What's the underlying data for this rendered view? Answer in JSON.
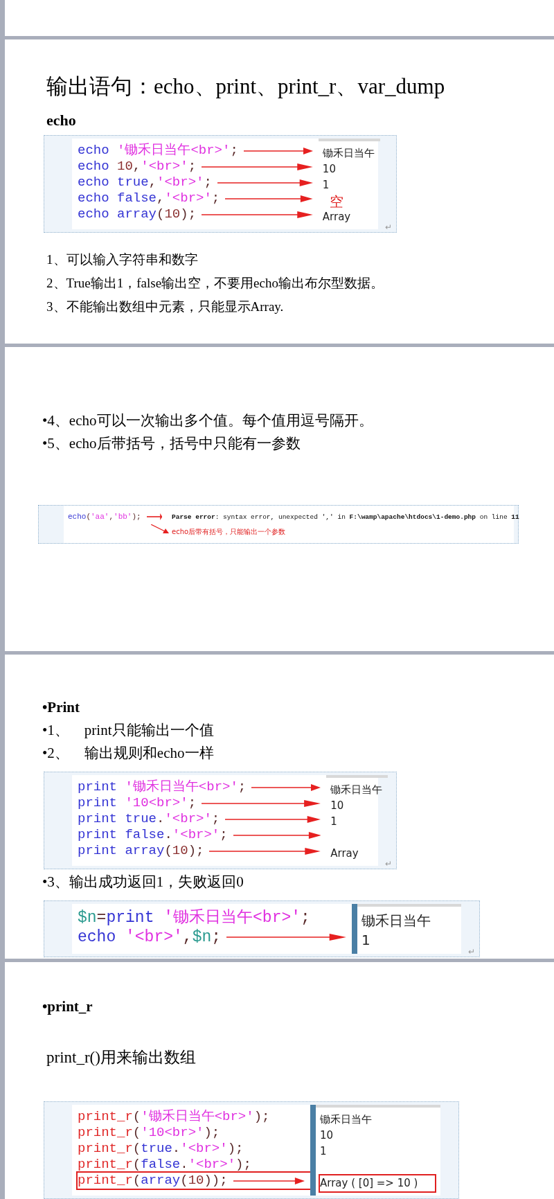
{
  "slides": [
    {
      "blocks": [
        {
          "kind": "title",
          "text": "输出语句：echo、print、print_r、var_dump"
        },
        {
          "kind": "heading",
          "text": "echo"
        },
        {
          "kind": "code",
          "end_mark": "↵",
          "rows": [
            {
              "tokens": [
                {
                  "kind": "kw",
                  "text": "echo "
                },
                {
                  "kind": "str",
                  "text": "'锄禾日当午<br>'"
                },
                {
                  "kind": "punct",
                  "text": ";"
                }
              ],
              "arrow": true,
              "output": {
                "kind": "text",
                "text": "锄禾日当午"
              }
            },
            {
              "tokens": [
                {
                  "kind": "kw",
                  "text": "echo "
                },
                {
                  "kind": "num",
                  "text": "10"
                },
                {
                  "kind": "punct",
                  "text": ","
                },
                {
                  "kind": "str",
                  "text": "'<br>'"
                },
                {
                  "kind": "punct",
                  "text": ";"
                }
              ],
              "arrow": true,
              "output": {
                "kind": "text",
                "text": "10"
              }
            },
            {
              "tokens": [
                {
                  "kind": "kw",
                  "text": "echo true"
                },
                {
                  "kind": "punct",
                  "text": ","
                },
                {
                  "kind": "str",
                  "text": "'<br>'"
                },
                {
                  "kind": "punct",
                  "text": ";"
                }
              ],
              "arrow": true,
              "output": {
                "kind": "text",
                "text": "1"
              }
            },
            {
              "tokens": [
                {
                  "kind": "kw",
                  "text": "echo false"
                },
                {
                  "kind": "punct",
                  "text": ","
                },
                {
                  "kind": "str",
                  "text": "'<br>'"
                },
                {
                  "kind": "punct",
                  "text": ";"
                }
              ],
              "arrow": true,
              "output": {
                "kind": "note",
                "text": "空"
              }
            },
            {
              "tokens": [
                {
                  "kind": "kw",
                  "text": "echo array"
                },
                {
                  "kind": "punct",
                  "text": "("
                },
                {
                  "kind": "num",
                  "text": "10"
                },
                {
                  "kind": "punct",
                  "text": ");"
                }
              ],
              "arrow": true,
              "output": {
                "kind": "text",
                "text": "Array"
              }
            }
          ]
        },
        {
          "kind": "lines",
          "items": [
            "1、可以输入字符串和数字",
            "2、True输出1，false输出空，不要用echo输出布尔型数据。",
            "3、不能输出数组中元素，只能显示Array."
          ]
        }
      ]
    },
    {
      "blocks": [
        {
          "kind": "bullets",
          "items": [
            {
              "marker": "•",
              "text": "4、echo可以一次输出多个值。每个值用逗号隔开。",
              "bold": false
            },
            {
              "marker": "•",
              "text": "5、echo后带括号，括号中只能有一参数",
              "bold": false
            }
          ]
        },
        {
          "kind": "error",
          "tokens": [
            {
              "kind": "kw",
              "text": "echo"
            },
            {
              "kind": "punct",
              "text": "("
            },
            {
              "kind": "str",
              "text": "'aa'"
            },
            {
              "kind": "punct",
              "text": ","
            },
            {
              "kind": "str",
              "text": "'bb'"
            },
            {
              "kind": "punct",
              "text": ");"
            }
          ],
          "message": "**Parse error**: syntax error, unexpected ',' in **F:\\wamp\\apache\\htdocs\\1-demo.php** on line **11**",
          "note": "echo后带有括号，只能输出一个参数"
        }
      ]
    },
    {
      "blocks": [
        {
          "kind": "bullets",
          "items": [
            {
              "marker": "•",
              "text": "Print",
              "bold": true
            },
            {
              "marker": "•",
              "number": "1、",
              "text": "print只能输出一个值",
              "bold": false
            },
            {
              "marker": "•",
              "number": "2、",
              "text": "输出规则和echo一样",
              "bold": false
            }
          ]
        },
        {
          "kind": "code",
          "end_mark": "↵",
          "rows": [
            {
              "tokens": [
                {
                  "kind": "kw",
                  "text": "print "
                },
                {
                  "kind": "str",
                  "text": "'锄禾日当午<br>'"
                },
                {
                  "kind": "punct",
                  "text": ";"
                }
              ],
              "arrow": true,
              "output": {
                "kind": "text",
                "text": "锄禾日当午"
              }
            },
            {
              "tokens": [
                {
                  "kind": "kw",
                  "text": "print "
                },
                {
                  "kind": "str",
                  "text": "'10<br>'"
                },
                {
                  "kind": "punct",
                  "text": ";"
                }
              ],
              "arrow": true,
              "output": {
                "kind": "text",
                "text": "10"
              }
            },
            {
              "tokens": [
                {
                  "kind": "kw",
                  "text": "print true"
                },
                {
                  "kind": "punct",
                  "text": "."
                },
                {
                  "kind": "str",
                  "text": "'<br>'"
                },
                {
                  "kind": "punct",
                  "text": ";"
                }
              ],
              "arrow": true,
              "output": {
                "kind": "text",
                "text": "1"
              }
            },
            {
              "tokens": [
                {
                  "kind": "kw",
                  "text": "print false"
                },
                {
                  "kind": "punct",
                  "text": "."
                },
                {
                  "kind": "str",
                  "text": "'<br>'"
                },
                {
                  "kind": "punct",
                  "text": ";"
                }
              ],
              "arrow": true
            },
            {
              "tokens": [
                {
                  "kind": "kw",
                  "text": "print array"
                },
                {
                  "kind": "punct",
                  "text": "("
                },
                {
                  "kind": "num",
                  "text": "10"
                },
                {
                  "kind": "punct",
                  "text": ");"
                }
              ],
              "arrow": true,
              "output": {
                "kind": "text",
                "text": "Array"
              }
            }
          ]
        },
        {
          "kind": "bullets",
          "items": [
            {
              "marker": "•",
              "text": "3、输出成功返回1，失败返回0",
              "bold": false
            }
          ]
        },
        {
          "kind": "code",
          "end_mark": "↵",
          "rows": [
            {
              "tokens": [
                {
                  "kind": "var",
                  "text": "$n"
                },
                {
                  "kind": "punct",
                  "text": "="
                },
                {
                  "kind": "kw",
                  "text": "print "
                },
                {
                  "kind": "str",
                  "text": "'锄禾日当午<br>'"
                },
                {
                  "kind": "punct",
                  "text": ";"
                }
              ],
              "arrow": false,
              "output": {
                "kind": "text",
                "text": "锄禾日当午"
              }
            },
            {
              "tokens": [
                {
                  "kind": "kw",
                  "text": "echo "
                },
                {
                  "kind": "str",
                  "text": "'<br>'"
                },
                {
                  "kind": "punct",
                  "text": ","
                },
                {
                  "kind": "var",
                  "text": "$n"
                },
                {
                  "kind": "punct",
                  "text": ";"
                }
              ],
              "arrow": true,
              "output": {
                "kind": "text",
                "text": "1"
              }
            }
          ]
        }
      ]
    },
    {
      "blocks": [
        {
          "kind": "bullets",
          "items": [
            {
              "marker": "•",
              "text": "print_r",
              "bold": true
            }
          ]
        },
        {
          "kind": "text",
          "text": "print_r()用来输出数组"
        },
        {
          "kind": "code",
          "rows": [
            {
              "tokens": [
                {
                  "kind": "func",
                  "text": "print_r"
                },
                {
                  "kind": "punct",
                  "text": "("
                },
                {
                  "kind": "str",
                  "text": "'锄禾日当午<br>'"
                },
                {
                  "kind": "punct",
                  "text": ");"
                }
              ],
              "arrow": false,
              "boxed": false,
              "output": {
                "kind": "text",
                "text": "锄禾日当午"
              }
            },
            {
              "tokens": [
                {
                  "kind": "func",
                  "text": "print_r"
                },
                {
                  "kind": "punct",
                  "text": "("
                },
                {
                  "kind": "str",
                  "text": "'10<br>'"
                },
                {
                  "kind": "punct",
                  "text": ");"
                }
              ],
              "arrow": false,
              "boxed": false,
              "output": {
                "kind": "text",
                "text": "10"
              }
            },
            {
              "tokens": [
                {
                  "kind": "func",
                  "text": "print_r"
                },
                {
                  "kind": "punct",
                  "text": "("
                },
                {
                  "kind": "kw",
                  "text": "true"
                },
                {
                  "kind": "punct",
                  "text": "."
                },
                {
                  "kind": "str",
                  "text": "'<br>'"
                },
                {
                  "kind": "punct",
                  "text": ");"
                }
              ],
              "arrow": false,
              "boxed": false,
              "output": {
                "kind": "text",
                "text": "1"
              }
            },
            {
              "tokens": [
                {
                  "kind": "func",
                  "text": "print_r"
                },
                {
                  "kind": "punct",
                  "text": "("
                },
                {
                  "kind": "kw",
                  "text": "false"
                },
                {
                  "kind": "punct",
                  "text": "."
                },
                {
                  "kind": "str",
                  "text": "'<br>'"
                },
                {
                  "kind": "punct",
                  "text": ");"
                }
              ],
              "arrow": false,
              "boxed": false
            },
            {
              "tokens": [
                {
                  "kind": "func",
                  "text": "print_r"
                },
                {
                  "kind": "punct",
                  "text": "("
                },
                {
                  "kind": "kw",
                  "text": "array"
                },
                {
                  "kind": "punct",
                  "text": "("
                },
                {
                  "kind": "num",
                  "text": "10"
                },
                {
                  "kind": "punct",
                  "text": "));"
                }
              ],
              "arrow": true,
              "boxed": true,
              "output": {
                "kind": "text",
                "text": "Array ( [0] => 10 )"
              }
            }
          ]
        }
      ]
    }
  ]
}
